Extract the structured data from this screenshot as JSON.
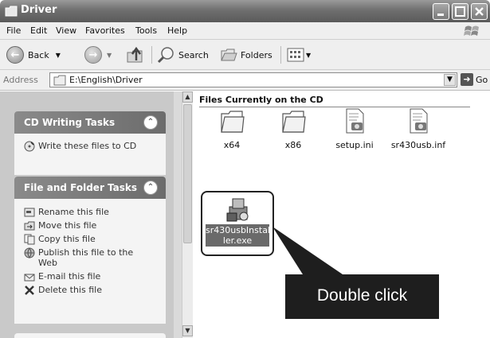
{
  "window": {
    "title": "Driver"
  },
  "menu": {
    "items": [
      {
        "label": "File"
      },
      {
        "label": "Edit"
      },
      {
        "label": "View"
      },
      {
        "label": "Favorites"
      },
      {
        "label": "Tools"
      },
      {
        "label": "Help"
      }
    ]
  },
  "toolbar": {
    "back_label": "Back",
    "search_label": "Search",
    "folders_label": "Folders"
  },
  "address": {
    "label": "Address",
    "value": "E:\\English\\Driver",
    "go_label": "Go"
  },
  "tasks": {
    "cd_panel": {
      "title": "CD Writing Tasks",
      "items": [
        {
          "label": "Write these files to CD",
          "icon": "cd-write-icon"
        }
      ]
    },
    "file_panel": {
      "title": "File and Folder Tasks",
      "items": [
        {
          "label": "Rename this file",
          "icon": "rename-icon"
        },
        {
          "label": "Move this file",
          "icon": "move-icon"
        },
        {
          "label": "Copy this file",
          "icon": "copy-icon"
        },
        {
          "label": "Publish this file to the",
          "label2": "Web",
          "icon": "publish-web-icon"
        },
        {
          "label": "E-mail this file",
          "icon": "email-icon"
        },
        {
          "label": "Delete this file",
          "icon": "delete-icon"
        }
      ]
    }
  },
  "content": {
    "group_title": "Files Currently on the CD",
    "files": [
      {
        "name": "x64",
        "type": "folder"
      },
      {
        "name": "x86",
        "type": "folder"
      },
      {
        "name": "setup.ini",
        "type": "ini"
      },
      {
        "name": "sr430usb.inf",
        "type": "inf"
      },
      {
        "name_line1": "sr430usbInstal",
        "name_line2": "ler.exe",
        "type": "exe",
        "selected": true
      }
    ]
  },
  "callout": {
    "text": "Double click"
  }
}
